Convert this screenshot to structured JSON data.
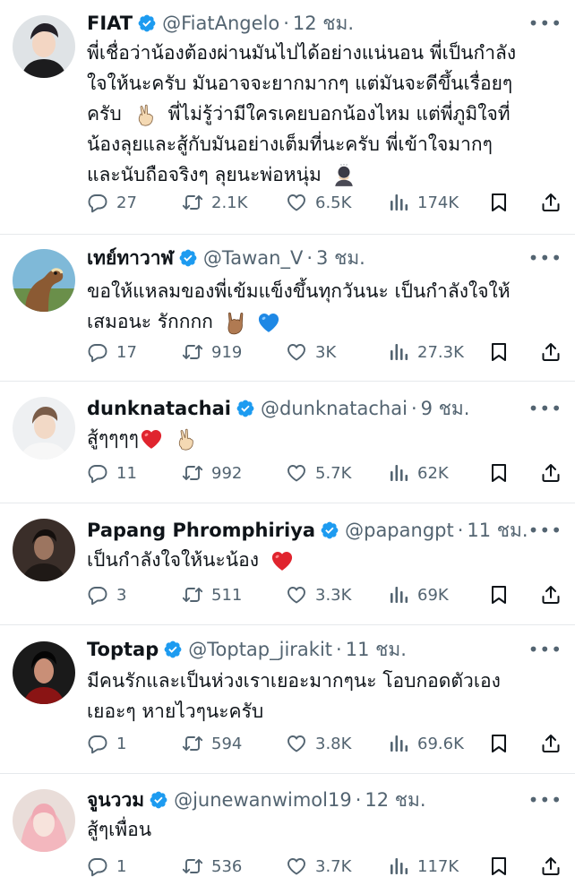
{
  "colors": {
    "accent": "#1d9bf0",
    "text": "#0f1419",
    "muted": "#536471",
    "heart": "#e0245e"
  },
  "icons": {
    "verified": "verified-badge-icon",
    "reply": "reply-icon",
    "retweet": "retweet-icon",
    "like": "heart-icon",
    "views": "views-chart-icon",
    "bookmark": "bookmark-icon",
    "share": "share-icon",
    "more": "more-icon"
  },
  "tweets": [
    {
      "name": "FIAT",
      "handle": "@FiatAngelo",
      "sep": "·",
      "time": "12 ชม.",
      "lines": [
        "พี่เชื่อว่าน้องต้องผ่านมันไปได้อย่างแน่นอน พี่เป็นกำลัง",
        "ใจให้นะครับ มันอาจจะยากมากๆ แต่มันจะดีขึ้นเรื่อยๆ",
        "ครับ",
        "พี่ไม่รู้ว่ามีใครเคยบอกน้องไหม แต่พี่ภูมิใจที่",
        "น้องลุยและสู้กับมันอย่างเต็มที่นะครับ พี่เข้าใจมากๆ",
        "และนับถือจริงๆ ลุยนะพ่อหนุ่ม"
      ],
      "replies": "27",
      "retweets": "2.1K",
      "likes": "6.5K",
      "views": "174K"
    },
    {
      "name": "เทย์ทาวาฬ",
      "handle": "@Tawan_V",
      "sep": "·",
      "time": "3 ชม.",
      "lines": [
        "ขอให้แหลมของพี่เข้มแข็งขึ้นทุกวันนะ เป็นกำลังใจให้",
        "เสมอนะ รักกกก"
      ],
      "replies": "17",
      "retweets": "919",
      "likes": "3K",
      "views": "27.3K"
    },
    {
      "name": "dunknatachai",
      "handle": "@dunknatachai",
      "sep": "·",
      "time": "9 ชม.",
      "lines": [
        "สู้ๆๆๆๆ"
      ],
      "replies": "11",
      "retweets": "992",
      "likes": "5.7K",
      "views": "62K"
    },
    {
      "name": "Papang Phromphiriya",
      "handle": "@papangpt",
      "sep": "·",
      "time": "11 ชม.",
      "lines": [
        "เป็นกำลังใจให้นะน้อง"
      ],
      "replies": "3",
      "retweets": "511",
      "likes": "3.3K",
      "views": "69K"
    },
    {
      "name": "Toptap",
      "handle": "@Toptap_jirakit",
      "sep": "·",
      "time": "11 ชม.",
      "lines": [
        "มีคนรักและเป็นห่วงเราเยอะมากๆนะ โอบกอดตัวเอง",
        "เยอะๆ หายไวๆนะครับ"
      ],
      "replies": "1",
      "retweets": "594",
      "likes": "3.8K",
      "views": "69.6K"
    },
    {
      "name": "จูนววม",
      "handle": "@junewanwimol19",
      "sep": "·",
      "time": "12 ชม.",
      "lines": [
        "สู้ๆเพื่อน"
      ],
      "replies": "1",
      "retweets": "536",
      "likes": "3.7K",
      "views": "117K"
    }
  ]
}
